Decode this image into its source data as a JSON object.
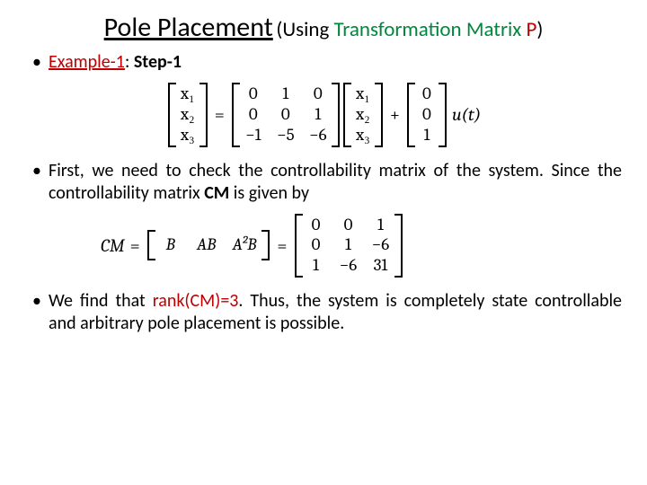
{
  "title": {
    "main": "Pole Placement",
    "sub_prefix": "(Using ",
    "sub_green": "Transformation Matrix",
    "sub_space": " ",
    "sub_red": "P",
    "sub_suffix": ")"
  },
  "bullet1": {
    "example_label": "Example-1",
    "colon": ": ",
    "step_label": "Step-1"
  },
  "eq1": {
    "x_labels": [
      "x₁",
      "x₂",
      "x₃"
    ],
    "A": [
      [
        "0",
        "1",
        "0"
      ],
      [
        "0",
        "0",
        "1"
      ],
      [
        "−1",
        "−5",
        "−6"
      ]
    ],
    "B": [
      "0",
      "0",
      "1"
    ],
    "eq_sign": "=",
    "plus_sign": "+",
    "u_tail": "u(t)"
  },
  "bullet2": {
    "text_a": "First, we need to check the controllability matrix of the system. Since the controllability matrix ",
    "cm": "CM",
    "text_b": " is given by"
  },
  "eq2": {
    "lhs": "CM",
    "eq1": "=",
    "row_labels": [
      "B",
      "AB",
      "A²B"
    ],
    "eq2": "=",
    "M": [
      [
        "0",
        "0",
        "1"
      ],
      [
        "0",
        "1",
        "−6"
      ],
      [
        "1",
        "−6",
        "31"
      ]
    ]
  },
  "bullet3": {
    "text_a": "We find that ",
    "rank": "rank(CM)=3",
    "text_b": ". Thus, the system is completely state controllable and arbitrary pole placement is possible."
  }
}
